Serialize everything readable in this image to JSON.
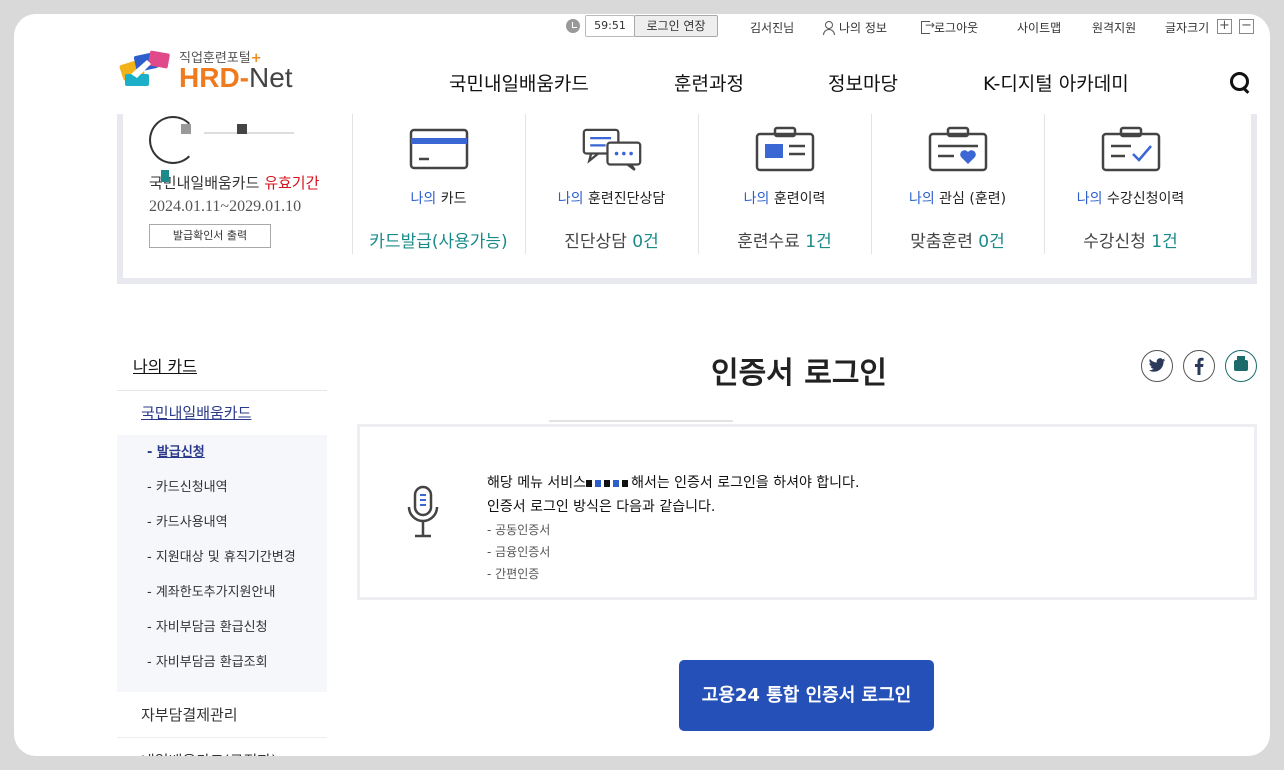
{
  "util": {
    "timer": "59:51",
    "extend_label": "로그인 연장",
    "user_name": "김서진님",
    "my_info": "나의 정보",
    "logout": "로그아웃",
    "sitemap": "사이트맵",
    "remote": "원격지원",
    "font_size": "글자크기",
    "font_plus": "+",
    "font_minus": "−"
  },
  "logo": {
    "sub": "직업훈련포털",
    "plus": "+",
    "main_hrd": "HRD",
    "main_dash": "-",
    "main_net": "Net"
  },
  "gnb": [
    "국민내일배움카드",
    "훈련과정",
    "정보마당",
    "K-디지털 아카데미"
  ],
  "profile": {
    "card_label_a": "국민내일배움카드",
    "card_label_b": "유효기간",
    "period": "2024.01.11~2029.01.10",
    "cert_button": "발급확인서 출력"
  },
  "summary": [
    {
      "prefix": "나의",
      "title": "카드",
      "value": "카드발급(사용가능)",
      "num": ""
    },
    {
      "prefix": "나의",
      "title": "훈련진단상담",
      "value": "진단상담",
      "num": "0건"
    },
    {
      "prefix": "나의",
      "title": "훈련이력",
      "value": "훈련수료",
      "num": "1건"
    },
    {
      "prefix": "나의",
      "title": "관심 (훈련)",
      "value": "맞춤훈련",
      "num": "0건"
    },
    {
      "prefix": "나의",
      "title": "수강신청이력",
      "value": "수강신청",
      "num": "1건"
    }
  ],
  "lnb": {
    "title": "나의 카드",
    "category": "국민내일배움카드",
    "subs": [
      "발급신청",
      "카드신청내역",
      "카드사용내역",
      "지원대상 및 휴직기간변경",
      "계좌한도추가지원안내",
      "자비부담금 환급신청",
      "자비부담금 환급조회"
    ],
    "items": [
      "자부담결제관리",
      "내일배움카드(구직자)"
    ]
  },
  "content": {
    "title": "인증서 로그인",
    "notice_line1_pre": "해당 메뉴 서비스",
    "notice_line1_post": "해서는 인증서 로그인을 하셔야 합니다.",
    "notice_line2": "인증서 로그인 방식은 다음과 같습니다.",
    "methods": [
      "- 공동인증서",
      "- 금융인증서",
      "- 간편인증"
    ],
    "login_button": "고용24 통합 인증서 로그인"
  },
  "colors": {
    "brand_blue": "#2550b8",
    "accent_orange": "#f07b1f",
    "teal": "#1b8a8a",
    "red": "#d5121b"
  }
}
